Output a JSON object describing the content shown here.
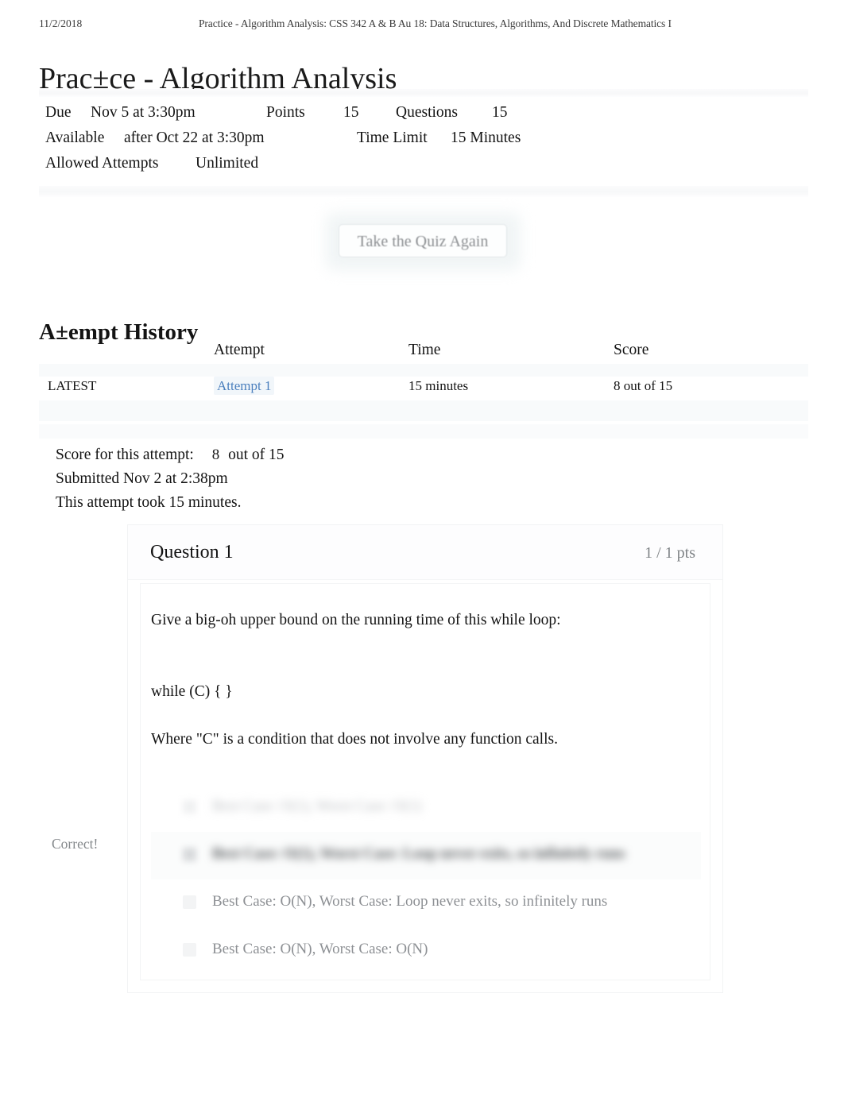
{
  "print_header": {
    "date": "11/2/2018",
    "course_title": "Practice - Algorithm Analysis: CSS 342 A & B Au 18: Data Structures, Algorithms, And Discrete Mathematics I"
  },
  "page_title": "Prac±ce - Algorithm Analysis",
  "quiz_details": {
    "due_label": "Due",
    "due_value": "Nov 5 at 3:30pm",
    "points_label": "Points",
    "points_value": "15",
    "questions_label": "Questions",
    "questions_value": "15",
    "available_label": "Available",
    "available_value": "after Oct 22 at 3:30pm",
    "time_limit_label": "Time Limit",
    "time_limit_value": "15 Minutes",
    "allowed_attempts_label": "Allowed Attempts",
    "allowed_attempts_value": "Unlimited"
  },
  "retake_button": {
    "label": "Take the Quiz Again"
  },
  "attempt_history": {
    "heading": "A±empt History",
    "columns": {
      "blank": "",
      "attempt": "Attempt",
      "time": "Time",
      "score": "Score"
    },
    "rows": [
      {
        "marker": "LATEST",
        "attempt": "Attempt 1",
        "time": "15 minutes",
        "score": "8 out of 15"
      }
    ]
  },
  "attempt_summary": {
    "score_label": "Score for this attempt:",
    "score_value": "8",
    "score_suffix": "out of 15",
    "submitted": "Submitted Nov 2 at 2:38pm",
    "duration": "This attempt took 15 minutes."
  },
  "question": {
    "title": "Question 1",
    "points": "1 / 1 pts",
    "prompt_line_1": "Give a big-oh upper bound on the running time of this while loop:",
    "prompt_line_2": "while (C) { }",
    "prompt_line_3": "Where \"C\" is a condition that does not involve any function calls.",
    "correct_label": "Correct!",
    "answers": [
      {
        "text": "Best Case: O(1), Worst Case: O(1)",
        "state": "blurred",
        "selected": false
      },
      {
        "text": "Best Case: O(1), Worst Case: Loop never exits, so infinitely runs",
        "state": "blurred",
        "selected": true
      },
      {
        "text": "Best Case: O(N), Worst Case: Loop never exits, so infinitely runs",
        "state": "visible",
        "selected": false
      },
      {
        "text": "Best Case: O(N), Worst Case: O(N)",
        "state": "visible",
        "selected": false
      }
    ]
  },
  "colors": {
    "link": "#4a7fbd",
    "muted_text": "#8d9094",
    "body_text": "#131313",
    "band": "#f7f8f9"
  }
}
